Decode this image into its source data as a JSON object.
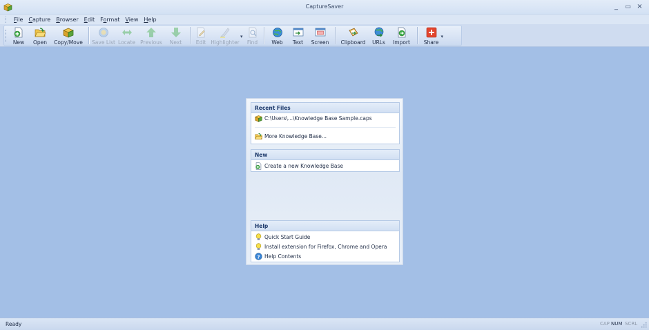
{
  "window": {
    "title": "CaptureSaver"
  },
  "menu": [
    {
      "pre": "",
      "ul": "F",
      "post": "ile"
    },
    {
      "pre": "",
      "ul": "C",
      "post": "apture"
    },
    {
      "pre": "",
      "ul": "B",
      "post": "rowser"
    },
    {
      "pre": "",
      "ul": "E",
      "post": "dit"
    },
    {
      "pre": "F",
      "ul": "o",
      "post": "rmat"
    },
    {
      "pre": "",
      "ul": "V",
      "post": "iew"
    },
    {
      "pre": "",
      "ul": "H",
      "post": "elp"
    }
  ],
  "toolbar": {
    "new": "New",
    "open": "Open",
    "copy_move": "Copy/Move",
    "save_list": "Save List",
    "locate": "Locate",
    "previous": "Previous",
    "next": "Next",
    "edit": "Edit",
    "highlighter": "Highlighter",
    "find": "Find",
    "web": "Web",
    "text": "Text",
    "screen": "Screen",
    "clipboard": "Clipboard",
    "urls": "URLs",
    "import": "Import",
    "share": "Share"
  },
  "start_panel": {
    "recent_files": {
      "header": "Recent Files",
      "items": [
        "C:\\Users\\...\\Knowledge Base Sample.caps"
      ],
      "more": "More Knowledge Base..."
    },
    "new": {
      "header": "New",
      "create": "Create a new Knowledge Base"
    },
    "help": {
      "header": "Help",
      "items": [
        "Quick Start Guide",
        "Install extension for Firefox, Chrome and Opera",
        "Help Contents"
      ]
    }
  },
  "status": {
    "ready": "Ready",
    "cap": "CAP",
    "num": "NUM",
    "scrl": "SCRL"
  },
  "colors": {
    "workspace": "#a3bfe6",
    "accent": "#1e3a6b"
  }
}
